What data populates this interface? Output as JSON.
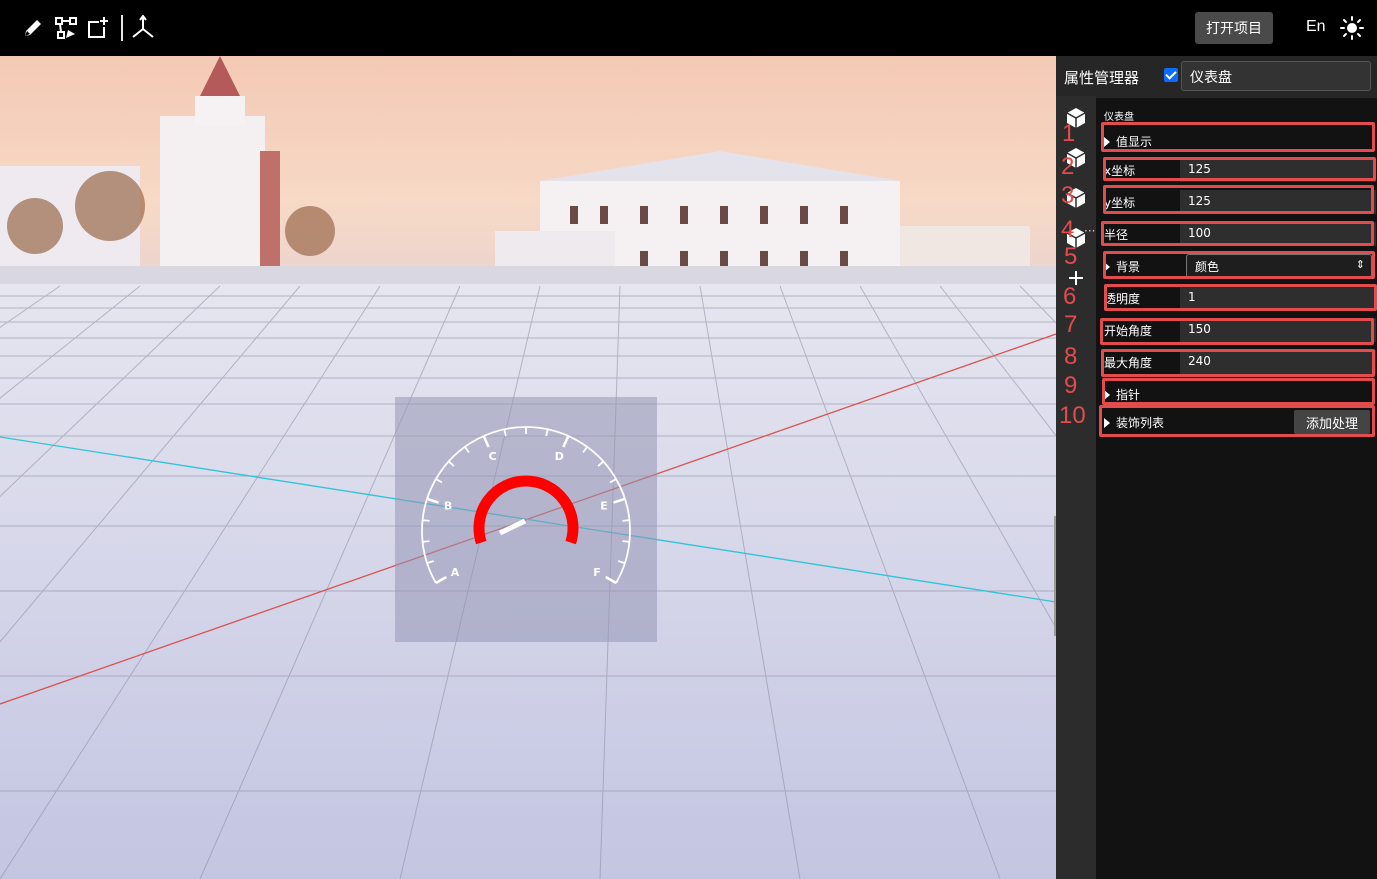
{
  "toolbar": {
    "tools": [
      "pencil-icon",
      "node-edit-icon",
      "add-frame-icon",
      "axis-icon"
    ],
    "open_project": "打开项目",
    "language": "En",
    "theme_icon": "sun-icon"
  },
  "viewport": {
    "gauge": {
      "tick_labels": [
        "A",
        "B",
        "C",
        "D",
        "E",
        "F"
      ],
      "value_arc_color": "#ff0000"
    }
  },
  "panel": {
    "title": "属性管理器",
    "visible_checked": true,
    "name_value": "仪表盘",
    "section_label": "仪表盘",
    "rows": {
      "value_display": "值显示",
      "x_label": "x坐标",
      "x_value": "125",
      "y_label": "y坐标",
      "y_value": "125",
      "radius_label": "半径",
      "radius_value": "100",
      "background_label": "背景",
      "background_value": "颜色",
      "opacity_label": "透明度",
      "opacity_value": "1",
      "start_angle_label": "开始角度",
      "start_angle_value": "150",
      "max_angle_label": "最大角度",
      "max_angle_value": "240",
      "pointer_label": "指针",
      "decoration_label": "装饰列表",
      "add_button": "添加处理"
    }
  },
  "annotations": [
    "1",
    "2",
    "3",
    "4",
    "5",
    "6",
    "7",
    "8",
    "9",
    "10"
  ],
  "colors": {
    "annotation": "#e24c4c",
    "accent": "#0b6cff",
    "x_axis": "#d9534f",
    "z_axis": "#2ec4d6"
  }
}
